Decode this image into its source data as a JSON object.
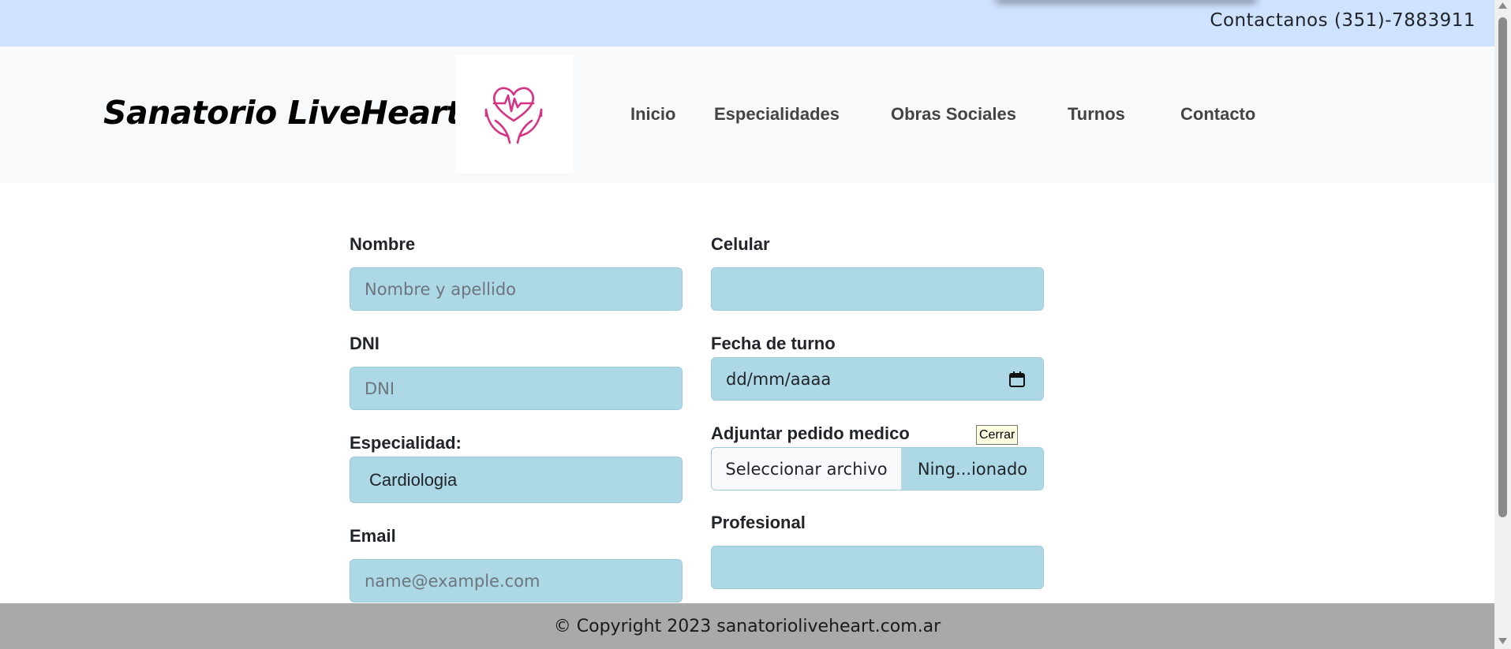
{
  "topbar": {
    "contact": "Contactanos (351)-7883911"
  },
  "header": {
    "brand": "Sanatorio LiveHeart",
    "logo_icon": "heart-hands-icon",
    "nav": [
      {
        "label": "Inicio"
      },
      {
        "label": "Especialidades"
      },
      {
        "label": "Obras Sociales"
      },
      {
        "label": "Turnos"
      },
      {
        "label": "Contacto"
      }
    ]
  },
  "form": {
    "nombre": {
      "label": "Nombre",
      "placeholder": "Nombre y apellido"
    },
    "celular": {
      "label": "Celular",
      "placeholder": ""
    },
    "dni": {
      "label": "DNI",
      "placeholder": "DNI"
    },
    "fecha": {
      "label": "Fecha de turno",
      "value": "dd/mm/aaaa",
      "icon": "calendar-icon"
    },
    "especialidad": {
      "label": "Especialidad:",
      "value": "Cardiologia"
    },
    "adjuntar": {
      "label": "Adjuntar pedido medico",
      "button": "Seleccionar archivo",
      "file": "Ning...ionado"
    },
    "email": {
      "label": "Email",
      "placeholder": "name@example.com"
    },
    "profesional": {
      "label": "Profesional",
      "value": ""
    }
  },
  "tooltip": "Cerrar",
  "footer": {
    "text": "© Copyright 2023 sanatorioliveheart.com.ar"
  },
  "colors": {
    "topbar": "#cfe2ff",
    "header": "#f8f9fa",
    "field": "#add8e6",
    "footer": "#a9a9a9",
    "logo_accent": "#d63384"
  }
}
